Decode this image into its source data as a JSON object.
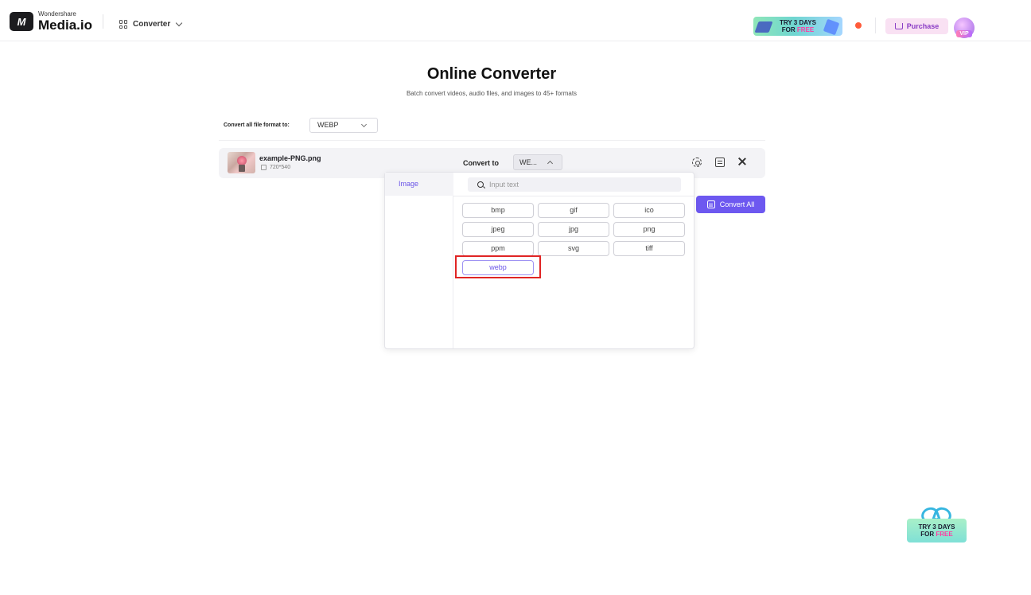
{
  "header": {
    "logo_mark": "M",
    "brand_small": "Wondershare",
    "brand_big": "Media.io",
    "nav_converter": "Converter",
    "promo_line1": "TRY 3 DAYS",
    "promo_for": "FOR",
    "promo_free": "FREE",
    "purchase": "Purchase",
    "vip": "VIP"
  },
  "page": {
    "title": "Online Converter",
    "subtitle": "Batch convert videos, audio files, and images to 45+ formats"
  },
  "format_all": {
    "label": "Convert all file format to:",
    "value": "WEBP"
  },
  "file": {
    "name": "example-PNG.png",
    "resolution": "720*540",
    "convert_to_label": "Convert to",
    "convert_to_value": "WE..."
  },
  "convert_all": "Convert All",
  "dropdown": {
    "category": "Image",
    "search_placeholder": "Input text",
    "formats": [
      "bmp",
      "gif",
      "ico",
      "jpeg",
      "jpg",
      "png",
      "ppm",
      "svg",
      "tiff",
      "webp"
    ],
    "selected": "webp"
  },
  "float_promo": {
    "line1": "TRY 3 DAYS",
    "for": "FOR",
    "free": "FREE"
  },
  "colors": {
    "accent": "#6d58f0",
    "highlight": "#e02424",
    "notification": "#ff5b3a"
  },
  "icons": [
    "media-io-logo-icon",
    "grid-icon",
    "chevron-down-icon",
    "cart-icon",
    "avatar",
    "resolution-icon",
    "chevron-up-icon",
    "gear-icon",
    "convert-icon",
    "close-icon",
    "search-icon",
    "gift-icon"
  ]
}
